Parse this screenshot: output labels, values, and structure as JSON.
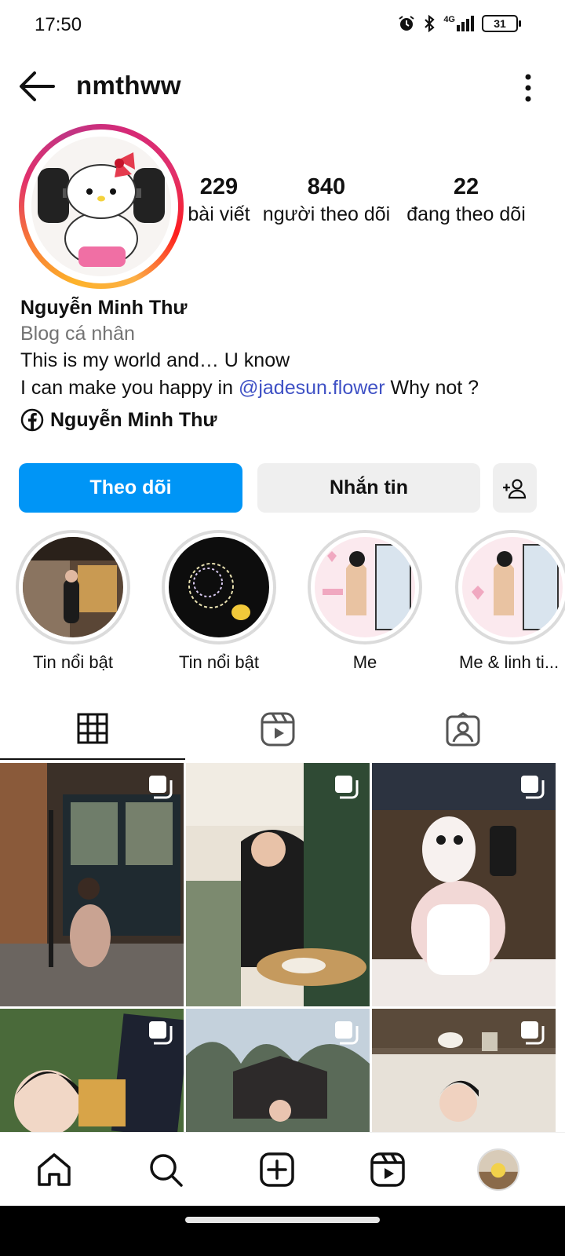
{
  "status_bar": {
    "time": "17:50",
    "network": "4G",
    "battery": "31"
  },
  "header": {
    "username": "nmthww"
  },
  "stats": {
    "posts": {
      "value": "229",
      "label": "bài viết"
    },
    "followers": {
      "value": "840",
      "label": "người theo dõi"
    },
    "following": {
      "value": "22",
      "label": "đang theo dõi"
    }
  },
  "bio": {
    "name": "Nguyễn Minh Thư",
    "category": "Blog cá nhân",
    "line1": "This is my world and… U know",
    "line2_before": "I can make you happy in ",
    "line2_mention": "@jadesun.flower",
    "line2_after": " Why not ?",
    "facebook_name": "Nguyễn Minh Thư"
  },
  "actions": {
    "follow": "Theo dõi",
    "message": "Nhắn tin"
  },
  "highlights": [
    {
      "label": "Tin nổi bật"
    },
    {
      "label": "Tin nổi bật"
    },
    {
      "label": "Me"
    },
    {
      "label": "Me & linh ti..."
    }
  ],
  "icons": {
    "back": "back-arrow-icon",
    "more": "more-vertical-icon",
    "facebook": "facebook-icon",
    "add_person": "add-person-icon",
    "grid_tab": "grid-icon",
    "reels_tab": "reels-icon",
    "tagged_tab": "tagged-icon",
    "multi_post": "carousel-icon"
  },
  "colors": {
    "follow_button": "#0095f6",
    "mention": "#3f51c5",
    "secondary_text": "#737373"
  }
}
